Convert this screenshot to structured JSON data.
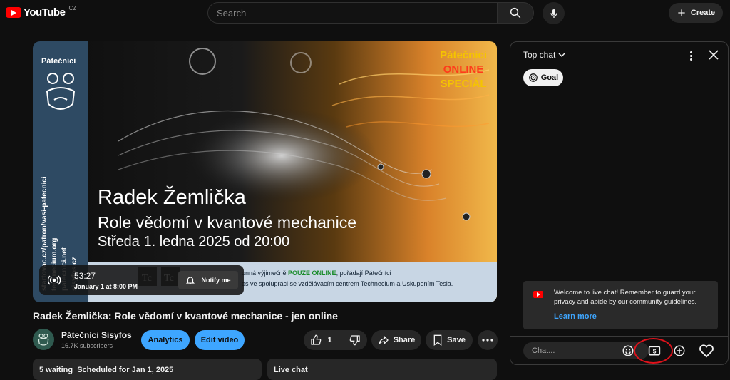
{
  "header": {
    "logo_text": "YouTube",
    "logo_region": "CZ",
    "search_placeholder": "Search",
    "create_label": "Create",
    "icons": [
      "youtube-logo",
      "search-icon",
      "mic-icon",
      "plus-icon"
    ]
  },
  "thumbnail": {
    "channel_badge": "Pátečníci",
    "side_urls": [
      "startovac.cz/patron/vasi-patecnici",
      "technecium.org",
      "patecnici.net",
      "sisyfos.cz"
    ],
    "promo": [
      "Pátečníci",
      "ONLINE",
      "SPECIÁL"
    ],
    "speaker": "Radek Žemlička",
    "topic": "Role vědomí v kvantové mechanice",
    "date_line": "Středa 1. ledna 2025 od 20:00",
    "info_line_1_a": "onná výjimečně ",
    "info_line_1_b": "POUZE ONLINE",
    "info_line_1_c": ", pořádají Pátečníci",
    "info_line_2": "os ve spolupráci se vzdělávacím centrem Technecium a Uskupením Tesla."
  },
  "overlay": {
    "countdown": "53:27",
    "scheduled": "January 1 at 8:00 PM",
    "notify_label": "Notify me"
  },
  "video": {
    "title": "Radek Žemlička: Role vědomí v kvantové mechanice - jen online",
    "channel_name": "Pátečníci Sisyfos",
    "subscribers": "16.7K subscribers",
    "analytics_label": "Analytics",
    "edit_label": "Edit video",
    "like_count": "1",
    "share_label": "Share",
    "save_label": "Save"
  },
  "below": {
    "waiting": "5 waiting",
    "scheduled": "Scheduled for Jan 1, 2025",
    "live_chat_label": "Live chat"
  },
  "chat": {
    "mode_label": "Top chat",
    "goal_label": "Goal",
    "welcome_text": "Welcome to live chat! Remember to guard your privacy and abide by our community guidelines.",
    "learn_more": "Learn more",
    "input_placeholder": "Chat...",
    "annotation_color": "#e0121b"
  }
}
